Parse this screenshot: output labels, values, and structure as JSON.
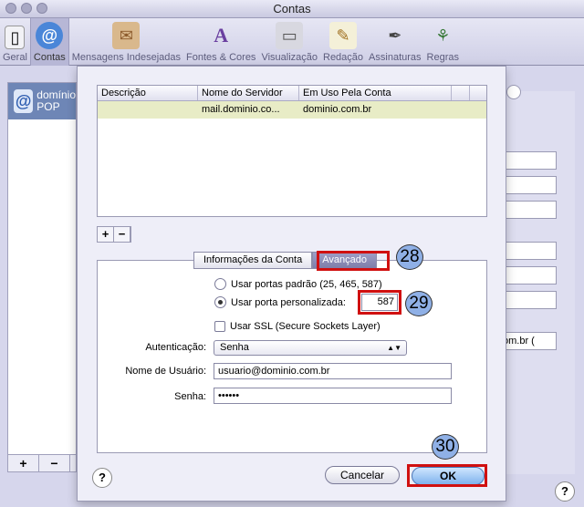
{
  "window": {
    "title": "Contas"
  },
  "toolbar": {
    "items": [
      {
        "label": "Geral",
        "icon": "gear-switch-icon"
      },
      {
        "label": "Contas",
        "icon": "at-sign-icon",
        "selected": true
      },
      {
        "label": "Mensagens Indesejadas",
        "icon": "junk-mail-icon"
      },
      {
        "label": "Fontes & Cores",
        "icon": "fonts-colors-icon"
      },
      {
        "label": "Visualização",
        "icon": "glasses-icon"
      },
      {
        "label": "Redação",
        "icon": "pencil-paper-icon"
      },
      {
        "label": "Assinaturas",
        "icon": "signature-pen-icon"
      },
      {
        "label": "Regras",
        "icon": "rules-icon"
      }
    ]
  },
  "accounts": {
    "items": [
      {
        "name": "domínio",
        "type": "POP"
      }
    ],
    "add_label": "+",
    "remove_label": "−"
  },
  "server_table": {
    "columns": [
      "Descrição",
      "Nome do Servidor",
      "Em Uso Pela Conta",
      ""
    ],
    "rows": [
      {
        "description": "",
        "server": "mail.dominio.co...",
        "in_use_by": "dominio.com.br"
      }
    ],
    "add_label": "+",
    "remove_label": "−"
  },
  "tabs": [
    {
      "label": "Informações da Conta"
    },
    {
      "label": "Avançado",
      "active": true
    }
  ],
  "advanced": {
    "default_ports_label": "Usar portas padrão (25, 465, 587)",
    "custom_port_label": "Usar porta personalizada:",
    "custom_port_value": "587",
    "ssl_label": "Usar SSL (Secure Sockets Layer)",
    "auth_label": "Autenticação:",
    "auth_value": "Senha",
    "username_label": "Nome de Usuário:",
    "username_value": "usuario@dominio.com.br",
    "password_label": "Senha:",
    "password_value": "••••••"
  },
  "buttons": {
    "cancel": "Cancelar",
    "ok": "OK",
    "help": "?"
  },
  "background": {
    "select_value": "om.br (",
    "help": "?"
  },
  "callouts": [
    "28",
    "29",
    "30"
  ],
  "colors": {
    "accent": "#7fb2ec",
    "highlight": "#d01010",
    "selection_row": "#e8ecc6"
  }
}
